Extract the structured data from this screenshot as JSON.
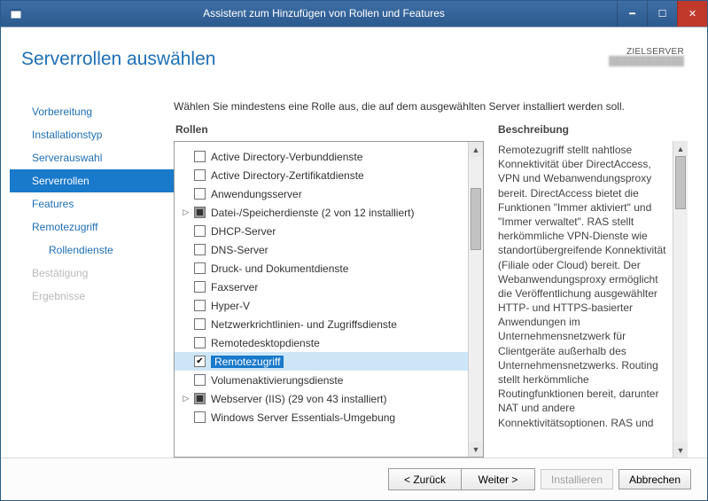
{
  "window": {
    "title": "Assistent zum Hinzufügen von Rollen und Features"
  },
  "header": {
    "page_title": "Serverrollen auswählen",
    "target_label": "ZIELSERVER",
    "target_value": "████████████"
  },
  "nav": {
    "items": [
      {
        "label": "Vorbereitung",
        "state": "normal"
      },
      {
        "label": "Installationstyp",
        "state": "normal"
      },
      {
        "label": "Serverauswahl",
        "state": "normal"
      },
      {
        "label": "Serverrollen",
        "state": "selected"
      },
      {
        "label": "Features",
        "state": "normal"
      },
      {
        "label": "Remotezugriff",
        "state": "normal"
      },
      {
        "label": "Rollendienste",
        "state": "indent"
      },
      {
        "label": "Bestätigung",
        "state": "disabled"
      },
      {
        "label": "Ergebnisse",
        "state": "disabled"
      }
    ]
  },
  "content": {
    "instructions": "Wählen Sie mindestens eine Rolle aus, die auf dem ausgewählten Server installiert werden soll.",
    "roles_header": "Rollen",
    "desc_header": "Beschreibung",
    "roles": [
      {
        "label": "Active Directory-Verbunddienste",
        "check": "unchecked",
        "toggle": ""
      },
      {
        "label": "Active Directory-Zertifikatdienste",
        "check": "unchecked",
        "toggle": ""
      },
      {
        "label": "Anwendungsserver",
        "check": "unchecked",
        "toggle": ""
      },
      {
        "label": "Datei-/Speicherdienste (2 von 12 installiert)",
        "check": "partial",
        "toggle": "▷"
      },
      {
        "label": "DHCP-Server",
        "check": "unchecked",
        "toggle": ""
      },
      {
        "label": "DNS-Server",
        "check": "unchecked",
        "toggle": ""
      },
      {
        "label": "Druck- und Dokumentdienste",
        "check": "unchecked",
        "toggle": ""
      },
      {
        "label": "Faxserver",
        "check": "unchecked",
        "toggle": ""
      },
      {
        "label": "Hyper-V",
        "check": "unchecked",
        "toggle": ""
      },
      {
        "label": "Netzwerkrichtlinien- und Zugriffsdienste",
        "check": "unchecked",
        "toggle": ""
      },
      {
        "label": "Remotedesktopdienste",
        "check": "unchecked",
        "toggle": ""
      },
      {
        "label": "Remotezugriff",
        "check": "checked",
        "toggle": "",
        "selected": true
      },
      {
        "label": "Volumenaktivierungsdienste",
        "check": "unchecked",
        "toggle": ""
      },
      {
        "label": "Webserver (IIS) (29 von 43 installiert)",
        "check": "partial",
        "toggle": "▷"
      },
      {
        "label": "Windows Server Essentials-Umgebung",
        "check": "unchecked",
        "toggle": ""
      }
    ],
    "description": "Remotezugriff stellt nahtlose Konnektivität über DirectAccess, VPN und Webanwendungsproxy bereit. DirectAccess bietet die Funktionen \"Immer aktiviert\" und \"Immer verwaltet\". RAS stellt herkömmliche VPN-Dienste wie standortübergreifende Konnektivität (Filiale oder Cloud) bereit. Der Webanwendungsproxy ermöglicht die Veröffentlichung ausgewählter HTTP- und HTTPS-basierter Anwendungen im Unternehmensnetzwerk für Clientgeräte außerhalb des Unternehmensnetzwerks. Routing stellt herkömmliche Routingfunktionen bereit, darunter NAT und andere Konnektivitätsoptionen. RAS und"
  },
  "footer": {
    "back": "< Zurück",
    "next": "Weiter >",
    "install": "Installieren",
    "cancel": "Abbrechen"
  }
}
